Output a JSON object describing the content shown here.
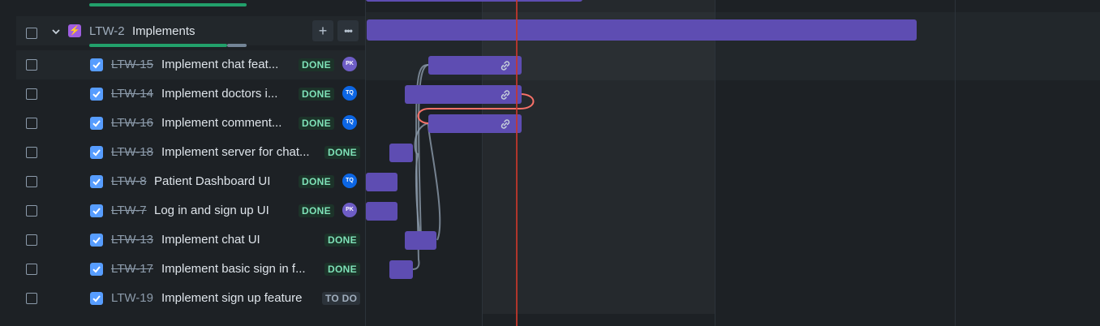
{
  "epic": {
    "key": "LTW-2",
    "title": "Implements",
    "add_label": "+",
    "more_label": "•••",
    "progress_done_fraction": 0.88
  },
  "tasks": [
    {
      "key": "LTW-15",
      "title": "Implement chat feat...",
      "status": "DONE",
      "assignee": "PK",
      "assignee_color": "#6e5dc6",
      "done": true
    },
    {
      "key": "LTW-14",
      "title": "Implement doctors i...",
      "status": "DONE",
      "assignee": "TQ",
      "assignee_color": "#0c66e4",
      "done": true
    },
    {
      "key": "LTW-16",
      "title": "Implement comment...",
      "status": "DONE",
      "assignee": "TQ",
      "assignee_color": "#0c66e4",
      "done": true
    },
    {
      "key": "LTW-18",
      "title": "Implement server for chat...",
      "status": "DONE",
      "assignee": "",
      "assignee_color": "",
      "done": true
    },
    {
      "key": "LTW-8",
      "title": "Patient Dashboard UI",
      "status": "DONE",
      "assignee": "TQ",
      "assignee_color": "#0c66e4",
      "done": true
    },
    {
      "key": "LTW-7",
      "title": "Log in and sign up UI",
      "status": "DONE",
      "assignee": "PK",
      "assignee_color": "#6e5dc6",
      "done": true
    },
    {
      "key": "LTW-13",
      "title": "Implement chat UI",
      "status": "DONE",
      "assignee": "",
      "assignee_color": "",
      "done": true
    },
    {
      "key": "LTW-17",
      "title": "Implement basic sign in f...",
      "status": "DONE",
      "assignee": "",
      "assignee_color": "",
      "done": true
    },
    {
      "key": "LTW-19",
      "title": "Implement sign up feature",
      "status": "TO DO",
      "assignee": "",
      "assignee_color": "",
      "done": true
    }
  ],
  "colors": {
    "bar": "#5e4db2",
    "today": "#c9372c",
    "dependency": "#8c9bab",
    "dependency_conflict": "#f87168",
    "done_badge": "#7ee2b8",
    "progress_done": "#22a06b"
  },
  "icons": [
    "chevron-down-icon",
    "epic-lightning-icon",
    "checkbox-icon",
    "link-icon",
    "plus-icon",
    "more-icon"
  ]
}
